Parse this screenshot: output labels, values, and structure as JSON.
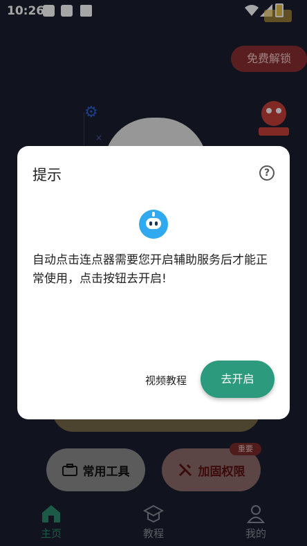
{
  "statusbar": {
    "time": "10:26"
  },
  "background": {
    "unlock_label": "免费解锁",
    "tools": {
      "common_label": "常用工具",
      "secure_label": "加固权限",
      "badge": "重要"
    }
  },
  "tabs": [
    {
      "label": "主页"
    },
    {
      "label": "教程"
    },
    {
      "label": "我的"
    }
  ],
  "dialog": {
    "title": "提示",
    "help_symbol": "?",
    "message": "自动点击连点器需要您开启辅助服务后才能正常使用，点击按钮去开启!",
    "video_label": "视频教程",
    "go_label": "去开启"
  },
  "colors": {
    "accent": "#2c9a7c",
    "background": "#1b1f2e",
    "bot": "#31a9f0"
  }
}
